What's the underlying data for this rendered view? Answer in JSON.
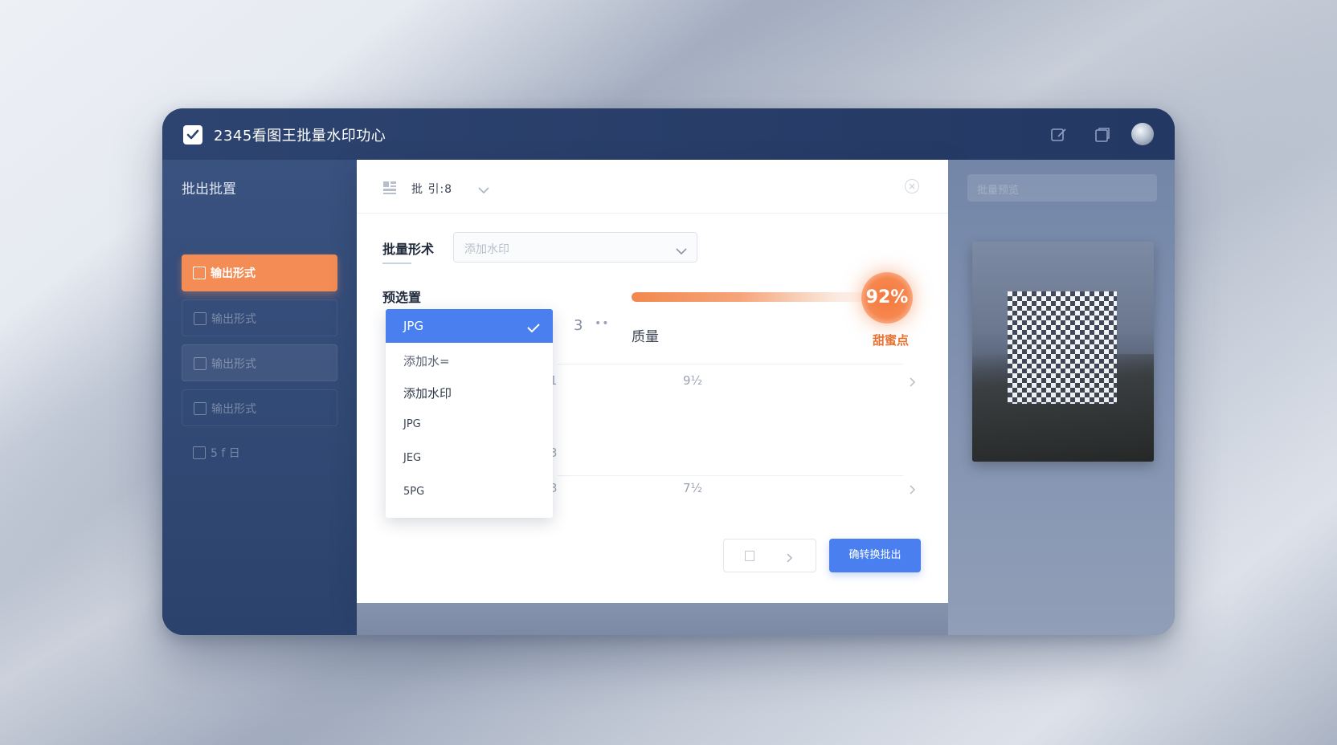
{
  "app": {
    "title": "2345看图王批量水印功心"
  },
  "sidebar": {
    "title": "批出批置",
    "items": [
      {
        "label": "输出形式",
        "active": true
      },
      {
        "label": "输出形式",
        "active": false
      },
      {
        "label": "输出形式",
        "active": false
      },
      {
        "label": "输出形式",
        "active": false
      },
      {
        "label": "5 f 日",
        "active": false
      }
    ]
  },
  "panel": {
    "header_title": "批 引:8",
    "batch_label": "批量形术",
    "batch_select_value": "添加水印",
    "preset_label": "预选置",
    "dropdown": {
      "selected": "JPG",
      "options": [
        "添加水=",
        "添加水印",
        "JPG",
        "JEG",
        "5PG"
      ]
    },
    "slider": {
      "value_text": "92%",
      "value": 92,
      "caption": "甜蜜点"
    },
    "count_text": "3",
    "dots": "••",
    "quality_label": "质量",
    "rows": [
      {
        "col1": "1",
        "col2": "9½"
      },
      {
        "col1": "3",
        "col2": ""
      },
      {
        "col1": "3",
        "col2": "7½"
      }
    ],
    "primary_button": "确转换批出"
  },
  "right": {
    "search_placeholder": "批量预览"
  },
  "colors": {
    "accent_orange": "#f38c55",
    "accent_blue": "#4a7ff0",
    "navy": "#2b426c"
  }
}
